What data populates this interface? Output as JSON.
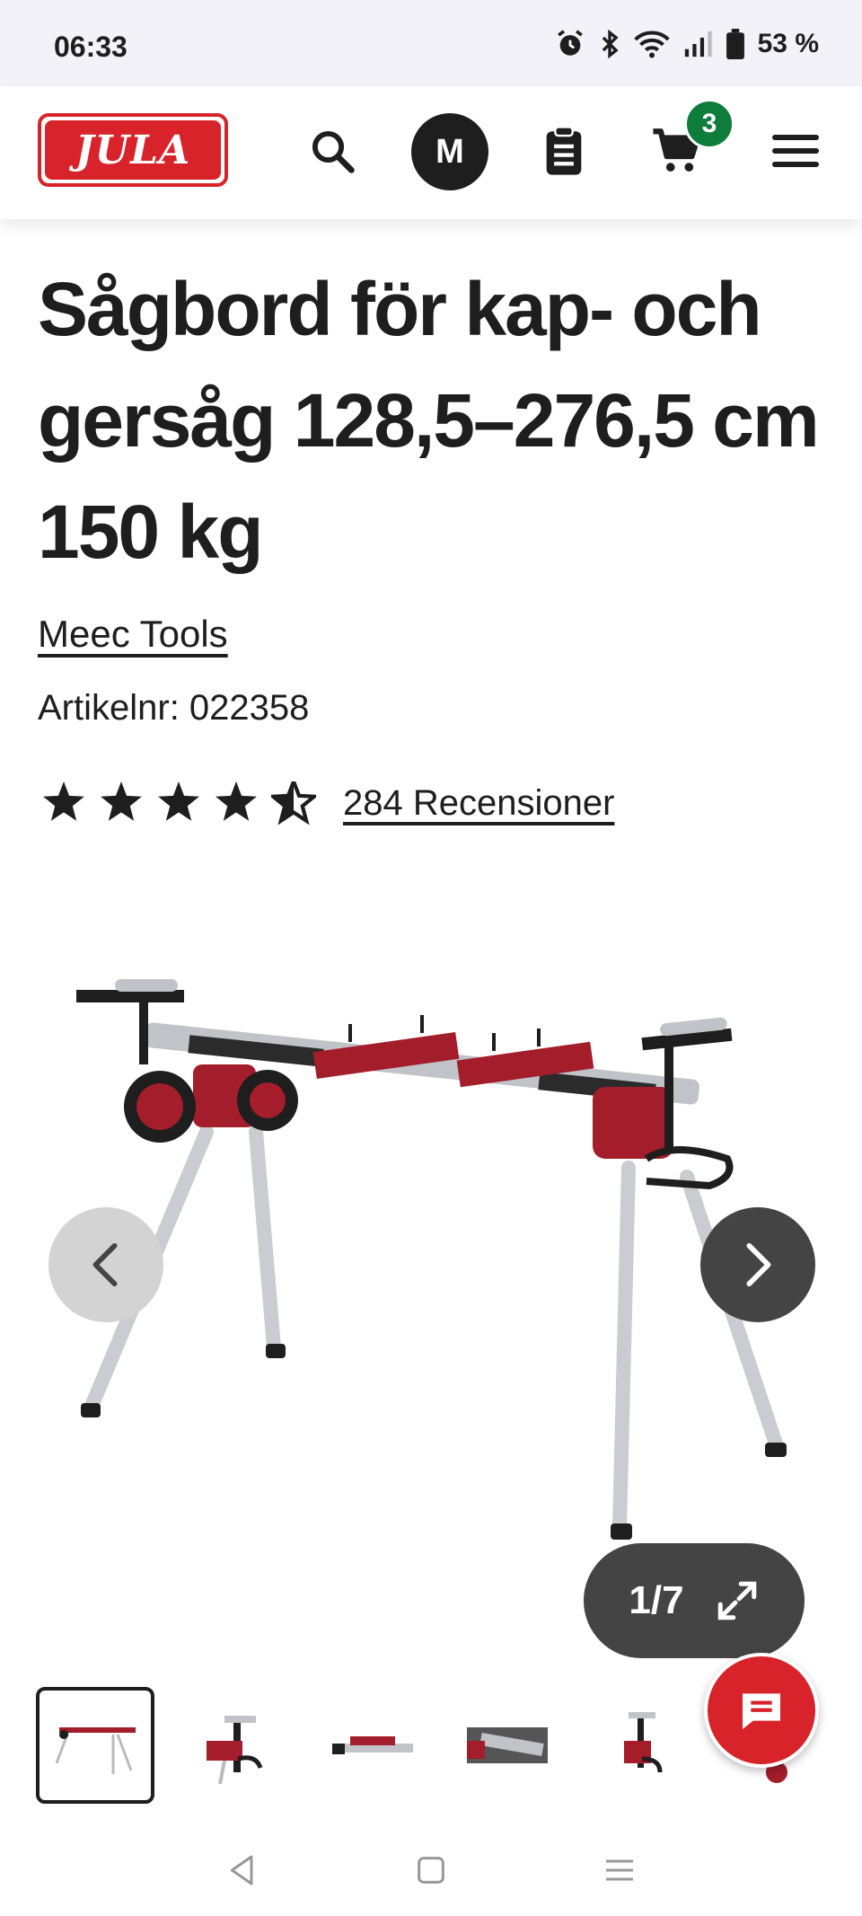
{
  "status": {
    "time": "06:33",
    "battery": "53 %"
  },
  "header": {
    "logo_text": "JULA",
    "avatar_initial": "M",
    "cart_count": "3"
  },
  "product": {
    "title": "Sågbord för kap- och gersåg 128,5–276,5 cm 150 kg",
    "brand": "Meec Tools",
    "article_number": "Artikelnr: 022358",
    "rating": 4.5,
    "reviews": "284 Recensioner"
  },
  "gallery": {
    "counter": "1/7",
    "thumbnail_count": 6
  },
  "colors": {
    "brand_red": "#d8232a",
    "badge_green": "#0e7c3a",
    "dark": "#1e1e1e",
    "dark_gray": "#444444"
  }
}
